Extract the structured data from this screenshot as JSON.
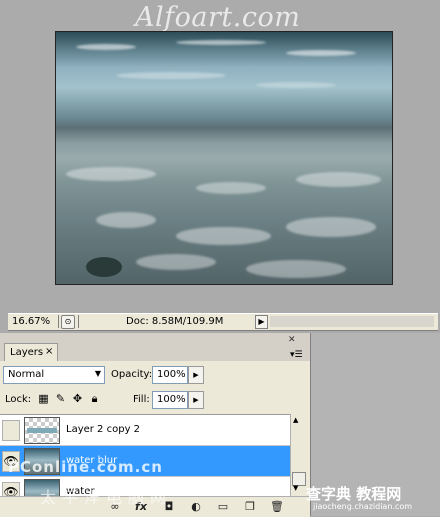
{
  "watermark_top": "Alfoart.com",
  "status": {
    "zoom": "16.67%",
    "doc": "Doc: 8.58M/109.9M",
    "arrow": "▶"
  },
  "panel": {
    "tab_label": "Layers",
    "tab_close": "×",
    "small_close": "✕",
    "menu_icon": "▾☰",
    "blend_mode": "Normal",
    "opacity_label": "Opacity:",
    "opacity_value": "100%",
    "lock_label": "Lock:",
    "fill_label": "Fill:",
    "fill_value": "100%",
    "layers": [
      {
        "name": "Layer 2 copy 2",
        "visible": false,
        "selected": false
      },
      {
        "name": "water blur",
        "visible": true,
        "selected": true
      },
      {
        "name": "water",
        "visible": true,
        "selected": false
      }
    ],
    "footer_icons": [
      "link-icon",
      "fx-icon",
      "mask-icon",
      "adjustment-icon",
      "folder-icon",
      "new-layer-icon",
      "trash-icon"
    ]
  },
  "watermarks": {
    "left": "PConline.com.cn",
    "left2": "太平洋电脑网",
    "right": "查字典 教程网",
    "right_sub": "jiaocheng.chazidian.com"
  },
  "colors": {
    "selection": "#3399ff",
    "panel_bg": "#ece9d8",
    "workspace_bg": "#ababab"
  }
}
